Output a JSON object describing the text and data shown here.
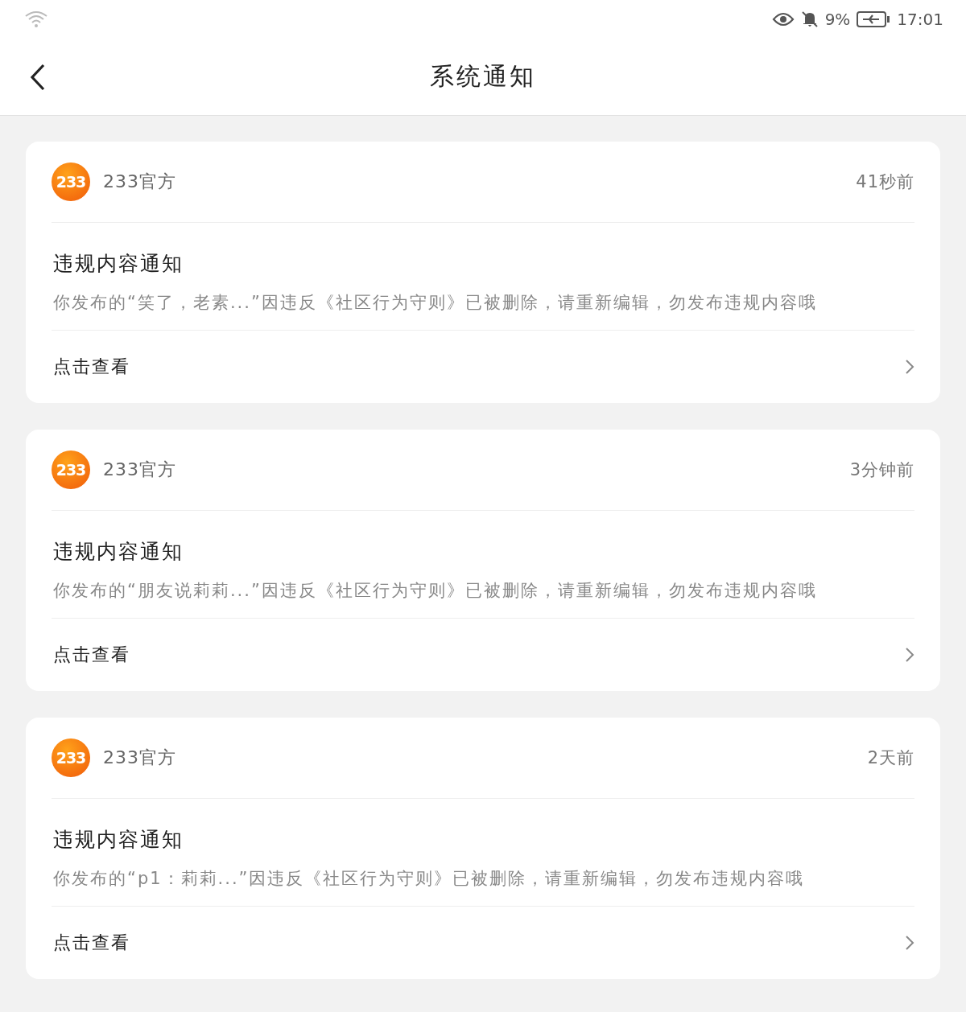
{
  "status_bar": {
    "battery_percent": "9%",
    "time": "17:01"
  },
  "header": {
    "title": "系统通知"
  },
  "notifications": [
    {
      "sender": "233官方",
      "logo_text": "233",
      "time": "41秒前",
      "title": "违规内容通知",
      "body": "你发布的“笑了，老素...”因违反《社区行为守则》已被删除，请重新编辑，勿发布违规内容哦",
      "action": "点击查看"
    },
    {
      "sender": "233官方",
      "logo_text": "233",
      "time": "3分钟前",
      "title": "违规内容通知",
      "body": "你发布的“朋友说莉莉...”因违反《社区行为守则》已被删除，请重新编辑，勿发布违规内容哦",
      "action": "点击查看"
    },
    {
      "sender": "233官方",
      "logo_text": "233",
      "time": "2天前",
      "title": "违规内容通知",
      "body": "你发布的“p1：莉莉...”因违反《社区行为守则》已被删除，请重新编辑，勿发布违规内容哦",
      "action": "点击查看"
    }
  ]
}
